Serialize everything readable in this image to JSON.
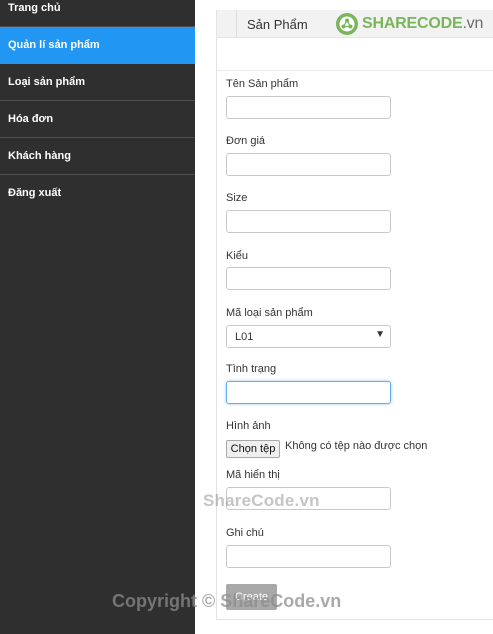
{
  "sidebar": {
    "items": [
      {
        "label": "Trang chủ"
      },
      {
        "label": "Quản lí sản phẩm",
        "active": true
      },
      {
        "label": "Loại sản phẩm"
      },
      {
        "label": "Hóa đơn"
      },
      {
        "label": "Khách hàng"
      },
      {
        "label": "Đăng xuất"
      }
    ],
    "active_color": "#2196f3",
    "background_color": "#2f2f2f"
  },
  "header": {
    "title": "Sản Phẩm",
    "logo": {
      "brand": "SHARECODE",
      "suffix": ".vn",
      "icon": "sharecode-logo-icon",
      "color": "#7ab55c"
    }
  },
  "form": {
    "ten_san_pham": {
      "label": "Tên Sản phẩm",
      "value": ""
    },
    "don_gia": {
      "label": "Đơn giá",
      "value": ""
    },
    "size": {
      "label": "Size",
      "value": ""
    },
    "kieu": {
      "label": "Kiểu",
      "value": ""
    },
    "ma_loai": {
      "label": "Mã loại sản phẩm",
      "selected": "L01"
    },
    "tinh_trang": {
      "label": "Tình trạng",
      "value": ""
    },
    "hinh_anh": {
      "label": "Hình ảnh",
      "button": "Chọn tệp",
      "status": "Không có tệp nào được chọn"
    },
    "ma_hien_thi": {
      "label": "Mã hiển thị",
      "value": ""
    },
    "ghi_chu": {
      "label": "Ghi chú",
      "value": ""
    },
    "create_button": "Create"
  },
  "watermarks": {
    "center": "ShareCode.vn",
    "bottom": "Copyright © ShareCode.vn"
  }
}
